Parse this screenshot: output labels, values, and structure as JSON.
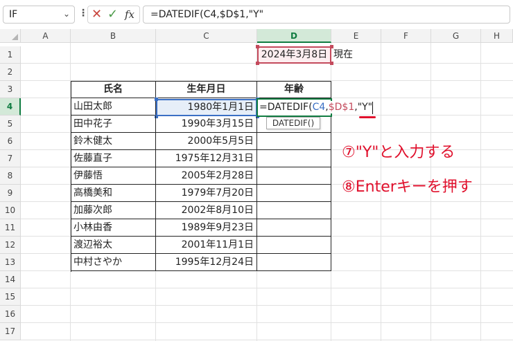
{
  "formula_bar": {
    "name_box": "IF",
    "cancel_symbol": "✕",
    "enter_symbol": "✓",
    "fx_label": "fx",
    "formula": "=DATEDIF(C4,$D$1,\"Y\""
  },
  "columns": [
    "A",
    "B",
    "C",
    "D",
    "E",
    "F",
    "G",
    "H"
  ],
  "rows": [
    "1",
    "2",
    "3",
    "4",
    "5",
    "6",
    "7",
    "8",
    "9",
    "10",
    "11",
    "12",
    "13",
    "14",
    "15",
    "16",
    "17"
  ],
  "selected_column": "D",
  "selected_row": "4",
  "cells": {
    "d1": "2024年3月8日",
    "e1": "現在"
  },
  "table": {
    "headers": [
      "氏名",
      "生年月日",
      "年齢"
    ],
    "rows": [
      {
        "name": "山田太郎",
        "birth": "1980年1月1日"
      },
      {
        "name": "田中花子",
        "birth": "1990年3月15日"
      },
      {
        "name": "鈴木健太",
        "birth": "2000年5月5日"
      },
      {
        "name": "佐藤直子",
        "birth": "1975年12月31日"
      },
      {
        "name": "伊藤悟",
        "birth": "2005年2月28日"
      },
      {
        "name": "高橋美和",
        "birth": "1979年7月20日"
      },
      {
        "name": "加藤次郎",
        "birth": "2002年8月10日"
      },
      {
        "name": "小林由香",
        "birth": "1989年9月23日"
      },
      {
        "name": "渡辺裕太",
        "birth": "2001年11月1日"
      },
      {
        "name": "中村さやか",
        "birth": "1995年12月24日"
      }
    ]
  },
  "editing": {
    "prefix": "=DATEDIF(",
    "ref1": "C4",
    "sep1": ",",
    "ref2": "$D$1",
    "sep2": ",",
    "arg": "\"Y\"",
    "tooltip": "DATEDIF()"
  },
  "annotations": {
    "step7": "⑦\"Y\"と入力する",
    "step8": "⑧Enterキーを押す"
  },
  "colors": {
    "accent_green": "#107c41",
    "ref_blue": "#3a6fc4",
    "ref_red": "#c44a5c",
    "annotation_red": "#e0102c"
  }
}
